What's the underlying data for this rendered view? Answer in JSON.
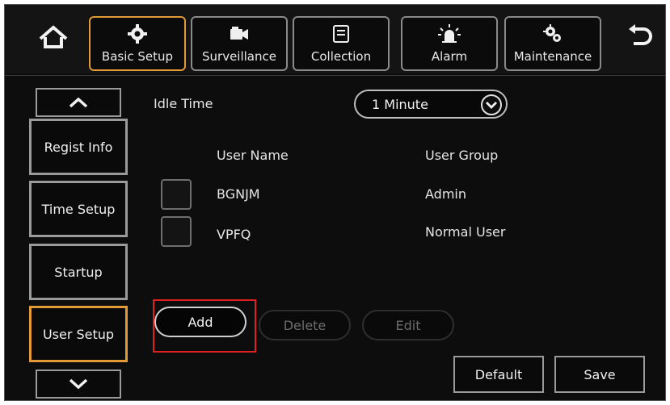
{
  "colors": {
    "active_border": "#e29a37",
    "highlight": "#e02020"
  },
  "topbar": {
    "home_icon": "home-icon",
    "back_icon": "back-arrow-icon",
    "tabs": [
      {
        "label": "Basic Setup",
        "icon": "gear-icon",
        "active": true
      },
      {
        "label": "Surveillance",
        "icon": "camera-icon",
        "active": false
      },
      {
        "label": "Collection",
        "icon": "storage-icon",
        "active": false
      },
      {
        "label": "Alarm",
        "icon": "siren-icon",
        "active": false
      },
      {
        "label": "Maintenance",
        "icon": "maintenance-gear-icon",
        "active": false
      }
    ]
  },
  "sidebar": {
    "up_icon": "chevron-up-icon",
    "down_icon": "chevron-down-icon",
    "items": [
      {
        "label": "Regist Info",
        "active": false
      },
      {
        "label": "Time Setup",
        "active": false
      },
      {
        "label": "Startup",
        "active": false
      },
      {
        "label": "User Setup",
        "active": true
      }
    ]
  },
  "main": {
    "idle_time_label": "Idle Time",
    "idle_time_value": "1 Minute",
    "columns": {
      "user_name": "User Name",
      "user_group": "User Group"
    },
    "users": [
      {
        "name": "BGNJM",
        "group": "Admin",
        "checked": false
      },
      {
        "name": "VPFQ",
        "group": "Normal User",
        "checked": false
      }
    ],
    "actions": {
      "add": "Add",
      "delete": "Delete",
      "edit": "Edit"
    },
    "footer": {
      "default": "Default",
      "save": "Save"
    }
  }
}
